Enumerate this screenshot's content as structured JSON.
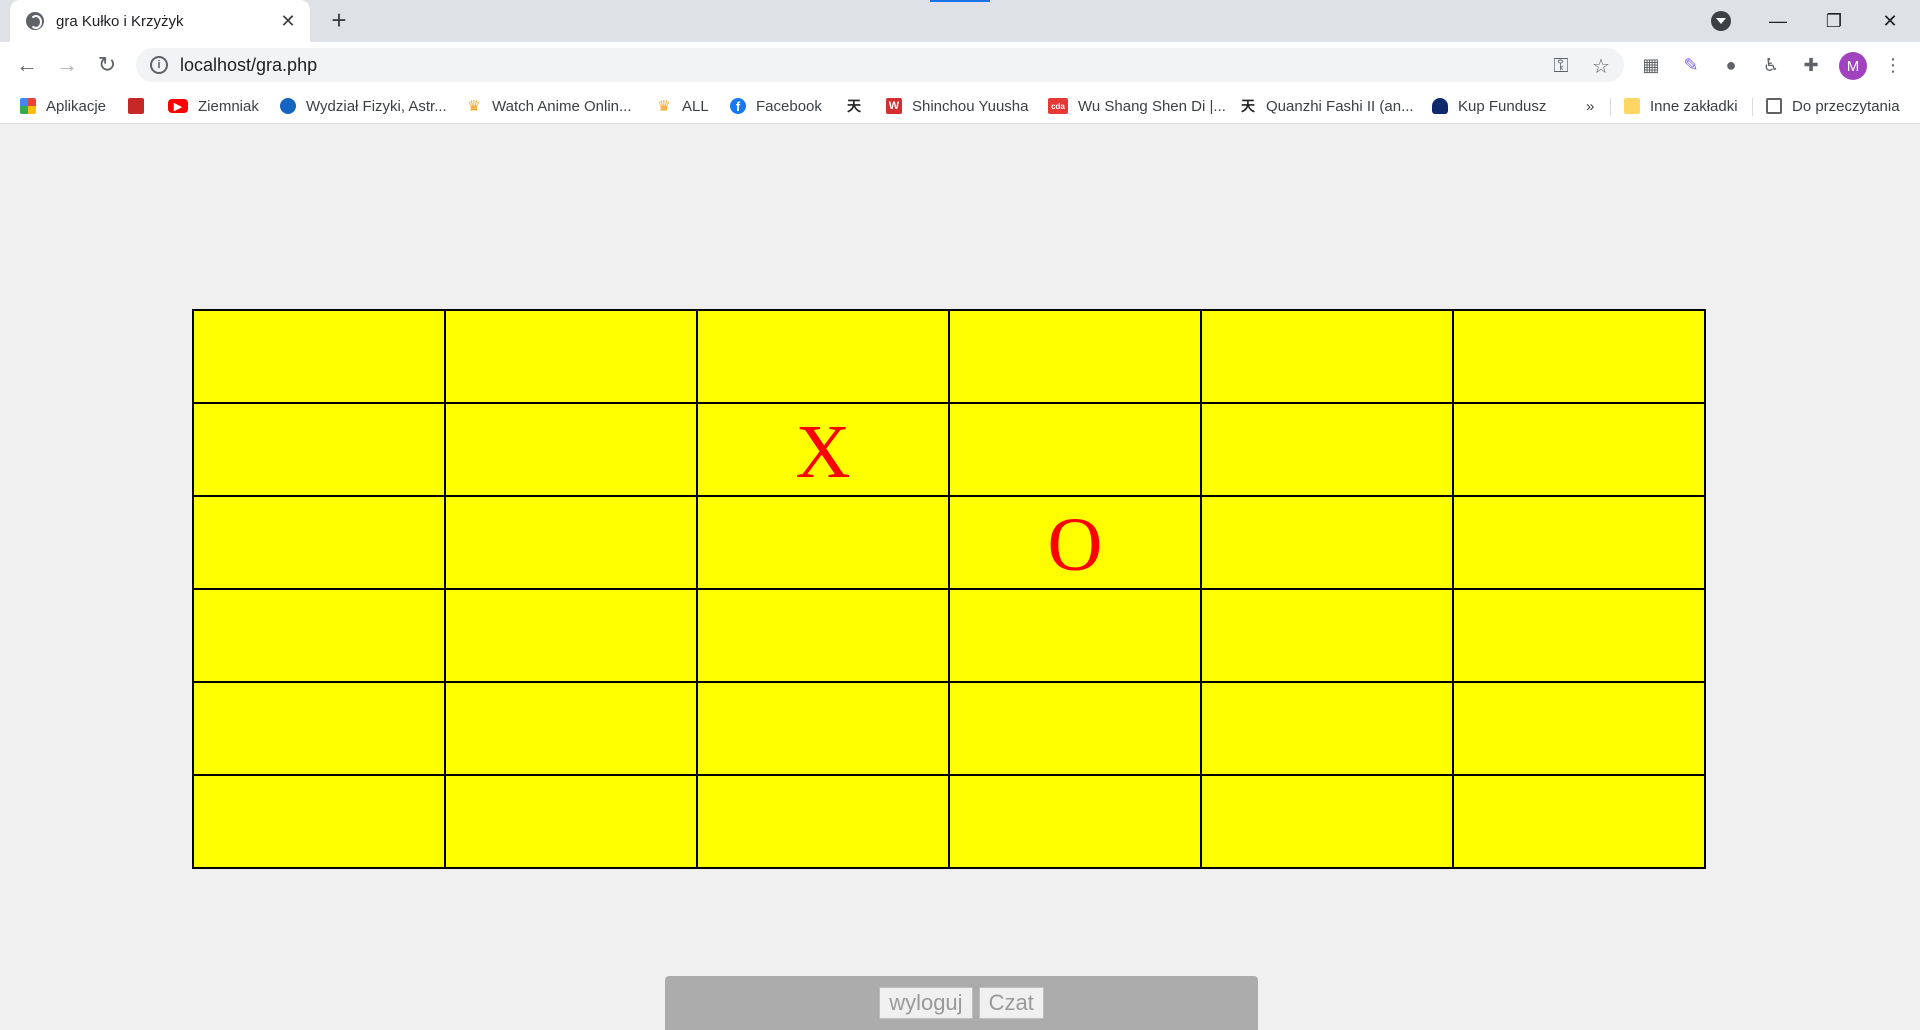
{
  "browser": {
    "tab": {
      "title": "gra Kułko i Krzyżyk",
      "close": "✕"
    },
    "new_tab": "+",
    "window_controls": {
      "minimize": "—",
      "restore": "❐",
      "close": "✕"
    },
    "address": {
      "url": "localhost/gra.php"
    },
    "avatar_initial": "M",
    "bookmarks": [
      {
        "label": "Aplikacje",
        "icon": "apps-grid-icon",
        "color": "#4285f4"
      },
      {
        "label": "",
        "icon": "game-icon",
        "color": "#c62828"
      },
      {
        "label": "Ziemniak",
        "icon": "youtube-icon",
        "color": "#ff0000"
      },
      {
        "label": "Wydział Fizyki, Astr...",
        "icon": "university-icon",
        "color": "#1565c0"
      },
      {
        "label": "Watch Anime Onlin...",
        "icon": "crown-icon",
        "color": "#f5a623"
      },
      {
        "label": "ALL",
        "icon": "crown-icon",
        "color": "#f5a623"
      },
      {
        "label": "Facebook",
        "icon": "facebook-icon",
        "color": "#1877f2"
      },
      {
        "label": "",
        "icon": "kanji-icon",
        "color": "#222222"
      },
      {
        "label": "Shinchou Yuusha",
        "icon": "w-icon",
        "color": "#d32f2f"
      },
      {
        "label": "Wu Shang Shen Di |...",
        "icon": "cda-icon",
        "color": "#e53935"
      },
      {
        "label": "Quanzhi Fashi II (an...",
        "icon": "kanji-icon",
        "color": "#222222"
      },
      {
        "label": "Kup Fundusz",
        "icon": "pko-icon",
        "color": "#0d2a6b"
      }
    ],
    "overflow": "»",
    "other_bookmarks": "Inne zakładki",
    "reading_list": "Do przeczytania"
  },
  "game": {
    "board": [
      [
        "",
        "",
        "",
        "",
        "",
        ""
      ],
      [
        "",
        "",
        "X",
        "",
        "",
        ""
      ],
      [
        "",
        "",
        "",
        "O",
        "",
        ""
      ],
      [
        "",
        "",
        "",
        "",
        "",
        ""
      ],
      [
        "",
        "",
        "",
        "",
        "",
        ""
      ],
      [
        "",
        "",
        "",
        "",
        "",
        ""
      ]
    ],
    "cell_color": "#ffff00",
    "mark_color": "#ff0000"
  },
  "footer": {
    "logout_label": "wyloguj",
    "chat_label": "Czat"
  }
}
